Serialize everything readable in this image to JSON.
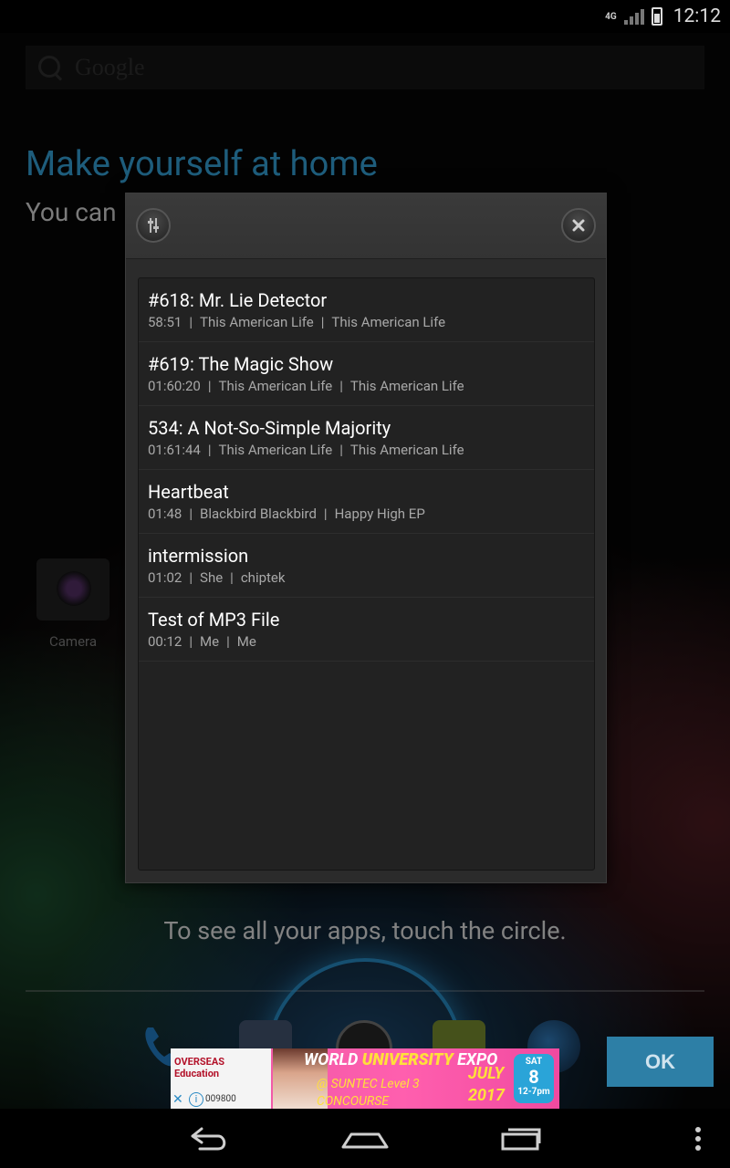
{
  "status_bar": {
    "network": "4G",
    "time": "12:12"
  },
  "search_bar": {
    "placeholder": "Google"
  },
  "home": {
    "title": "Make yourself at home",
    "subtitle": "You can",
    "camera_label": "Camera",
    "hint": "To see all your apps, touch the circle.",
    "ok_label": "OK"
  },
  "dialog": {
    "tracks": [
      {
        "title": "#618: Mr. Lie Detector",
        "duration": "58:51",
        "artist": "This American Life",
        "album": "This American Life"
      },
      {
        "title": "#619: The Magic Show",
        "duration": "01:60:20",
        "artist": "This American Life",
        "album": "This American Life"
      },
      {
        "title": "534: A Not-So-Simple Majority",
        "duration": "01:61:44",
        "artist": "This American Life",
        "album": "This American Life"
      },
      {
        "title": "Heartbeat",
        "duration": "01:48",
        "artist": "Blackbird Blackbird",
        "album": "Happy High EP"
      },
      {
        "title": "intermission",
        "duration": "01:02",
        "artist": "She",
        "album": "chiptek"
      },
      {
        "title": "Test of MP3 File",
        "duration": "00:12",
        "artist": "Me",
        "album": "Me"
      }
    ]
  },
  "ad": {
    "logo_line1": "OVERSEAS",
    "logo_line2": "Education",
    "title_world": "WORLD",
    "title_university": "UNIVERSITY",
    "title_expo": "EXPO",
    "venue_line1": "@ SUNTEC Level 3",
    "venue_line2": "CONCOURSE",
    "month": "JULY",
    "year": "2017",
    "badge_day_name": "SAT",
    "badge_day": "8",
    "badge_time": "12-7pm",
    "phone": "009800",
    "close_glyph": "✕",
    "info_glyph": "i"
  },
  "icons": {
    "settings": "equalizer-settings-icon",
    "close": "close-icon",
    "back": "back-icon",
    "home": "home-icon",
    "recents": "recents-icon",
    "menu": "overflow-menu-icon"
  }
}
